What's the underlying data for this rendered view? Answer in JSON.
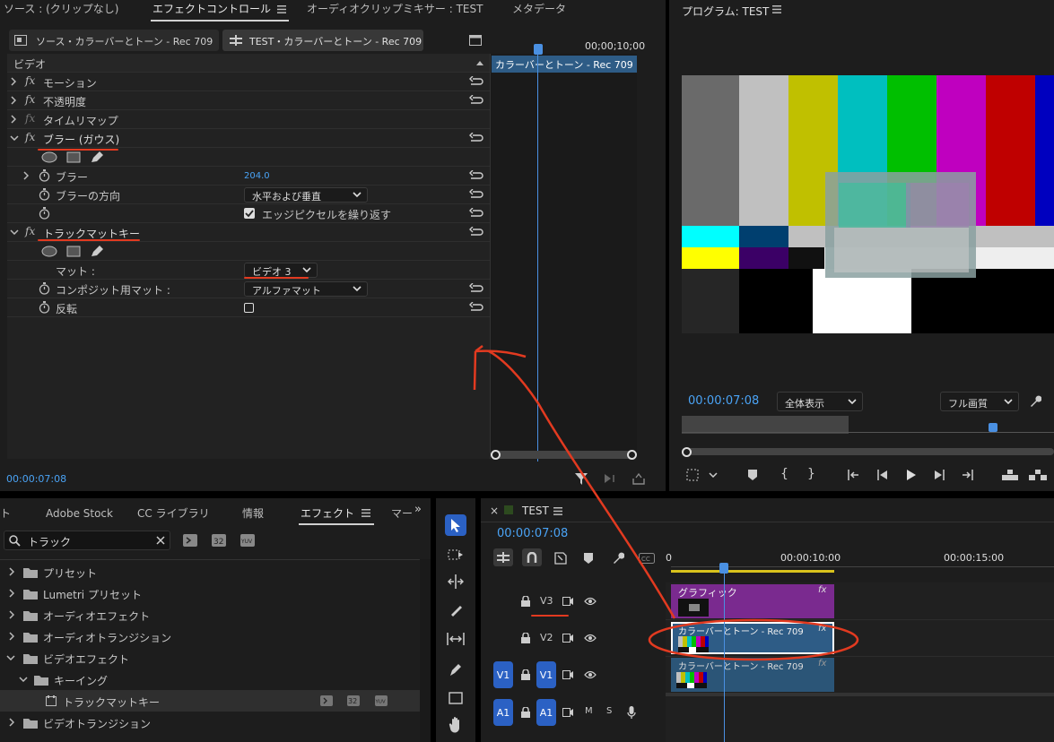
{
  "source_panel": {
    "tabs": [
      "ソース : (クリップなし)",
      "エフェクトコントロール",
      "オーディオクリップミキサー : TEST",
      "メタデータ"
    ],
    "clip_tab_source": "ソース・カラーバーとトーン - Rec 709",
    "clip_tab_test": "TEST・カラーバーとトーン - Rec 709",
    "timecode_ruler": "00;00;10;00",
    "clip_bar": "カラーバーとトーン - Rec 709",
    "video_header": "ビデオ",
    "effects": {
      "motion": "モーション",
      "opacity": "不透明度",
      "time_remap": "タイムリマップ",
      "blur_gauss": "ブラー (ガウス)",
      "blur_label": "ブラー",
      "blur_value": "204.0",
      "blur_direction": "ブラーの方向",
      "blur_direction_value": "水平および垂直",
      "repeat_edge": "エッジピクセルを繰り返す",
      "track_matte": "トラックマットキー",
      "matte_label": "マット :",
      "matte_value": "ビデオ 3",
      "composite_label": "コンポジット用マット :",
      "composite_value": "アルファマット",
      "invert_label": "反転"
    },
    "timecode_bottom": "00:00:07:08"
  },
  "program_monitor": {
    "title": "プログラム: TEST",
    "timecode": "00:00:07:08",
    "zoom_value": "全体表示",
    "quality_value": "フル画質",
    "colorbars_top": [
      "#6a6a6a",
      "#c0c0c0",
      "#c0c000",
      "#00bfbf",
      "#00bf00",
      "#bf00bf",
      "#bf0000",
      "#0000bf"
    ]
  },
  "effects_panel": {
    "tabs": [
      "ト",
      "Adobe Stock",
      "CC ライブラリ",
      "情報",
      "エフェクト",
      "マー"
    ],
    "search_value": "トラック",
    "tree": [
      {
        "label": "プリセット",
        "level": 0,
        "open": false
      },
      {
        "label": "Lumetri プリセット",
        "level": 0,
        "open": false
      },
      {
        "label": "オーディオエフェクト",
        "level": 0,
        "open": false
      },
      {
        "label": "オーディオトランジション",
        "level": 0,
        "open": false
      },
      {
        "label": "ビデオエフェクト",
        "level": 0,
        "open": true
      },
      {
        "label": "キーイング",
        "level": 1,
        "open": true
      },
      {
        "label": "トラックマットキー",
        "level": 2,
        "open": false
      },
      {
        "label": "ビデオトランジション",
        "level": 0,
        "open": false
      }
    ]
  },
  "timeline": {
    "sequence_name": "TEST",
    "timecode": "00:00:07:08",
    "ruler_labels": [
      "0",
      "00:00:10:00",
      "00:00:15:00"
    ],
    "tracks": {
      "v3": "V3",
      "v2": "V2",
      "v1": "V1",
      "a1": "A1",
      "src_v1": "V1",
      "src_a1": "A1",
      "m": "M",
      "s": "S"
    },
    "clips": {
      "graphic": "グラフィック",
      "colorbars_v2": "カラーバーとトーン - Rec 709",
      "colorbars_v1": "カラーバーとトーン - Rec 709",
      "fx": "fx"
    }
  }
}
